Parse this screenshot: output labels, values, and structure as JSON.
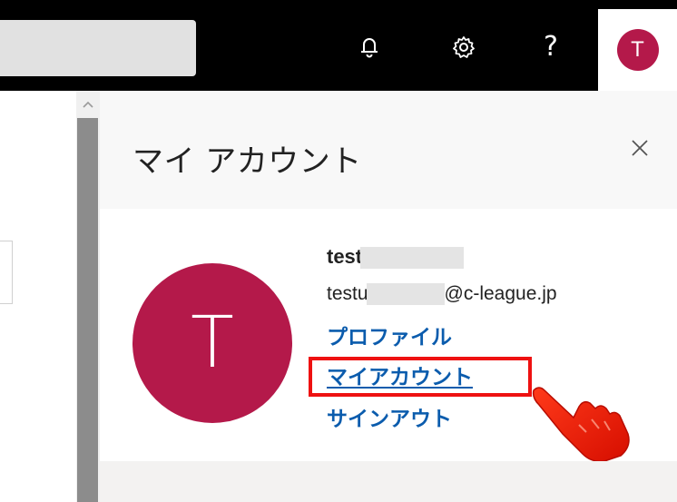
{
  "topbar": {
    "help_glyph": "?",
    "avatar_initial": "T"
  },
  "panel": {
    "title": "マイ アカウント",
    "close_glyph": "✕",
    "user": {
      "name_prefix": "test",
      "email_prefix": "testu",
      "email_suffix": "@c-league.jp",
      "avatar_initial": "T"
    },
    "links": {
      "profile": "プロファイル",
      "my_account": "マイアカウント",
      "sign_out": "サインアウト"
    }
  },
  "colors": {
    "avatar": "#b4194a",
    "link": "#0b5cad",
    "highlight": "#ee1111"
  },
  "icons": [
    "bell-icon",
    "gear-icon",
    "help-icon",
    "close-icon",
    "chevron-up-icon",
    "pointing-hand-icon"
  ]
}
